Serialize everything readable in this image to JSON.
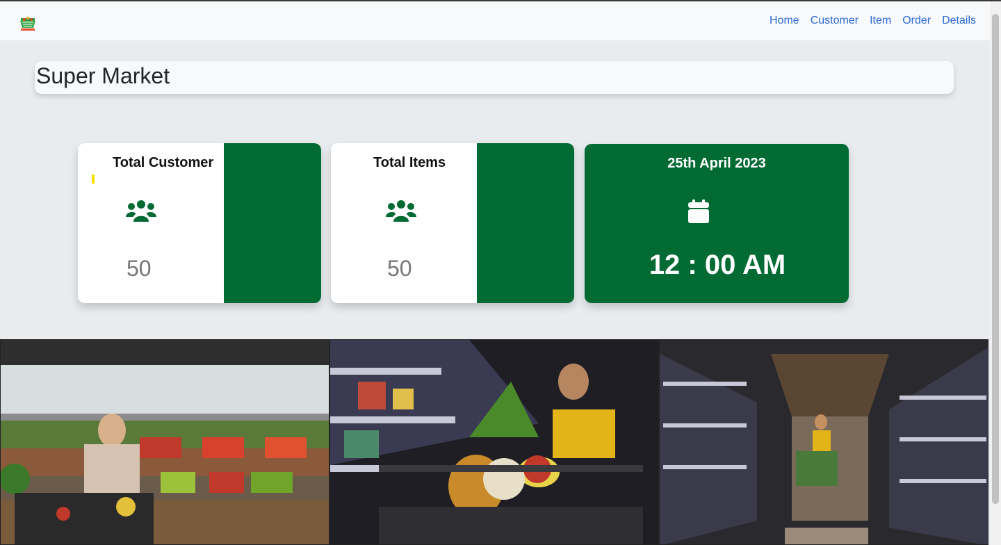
{
  "navbar": {
    "logo": "supermarket-logo",
    "links": [
      "Home",
      "Customer",
      "Item",
      "Order",
      "Details"
    ]
  },
  "page_title": "Super Market",
  "cards": {
    "customer": {
      "label": "Total Customer",
      "count": "50",
      "icon": "users-icon"
    },
    "items": {
      "label": "Total Items",
      "count": "50",
      "icon": "users-icon"
    },
    "datetime": {
      "date": "25th April 2023",
      "time": "12 : 00 AM",
      "icon": "calendar-icon"
    }
  },
  "colors": {
    "accent_green": "#026a33",
    "link_blue": "#2a6ad6",
    "background": "#e9ecef"
  },
  "photos": [
    "supermarket-produce-photo",
    "supermarket-cart-photo",
    "supermarket-aisle-photo"
  ]
}
